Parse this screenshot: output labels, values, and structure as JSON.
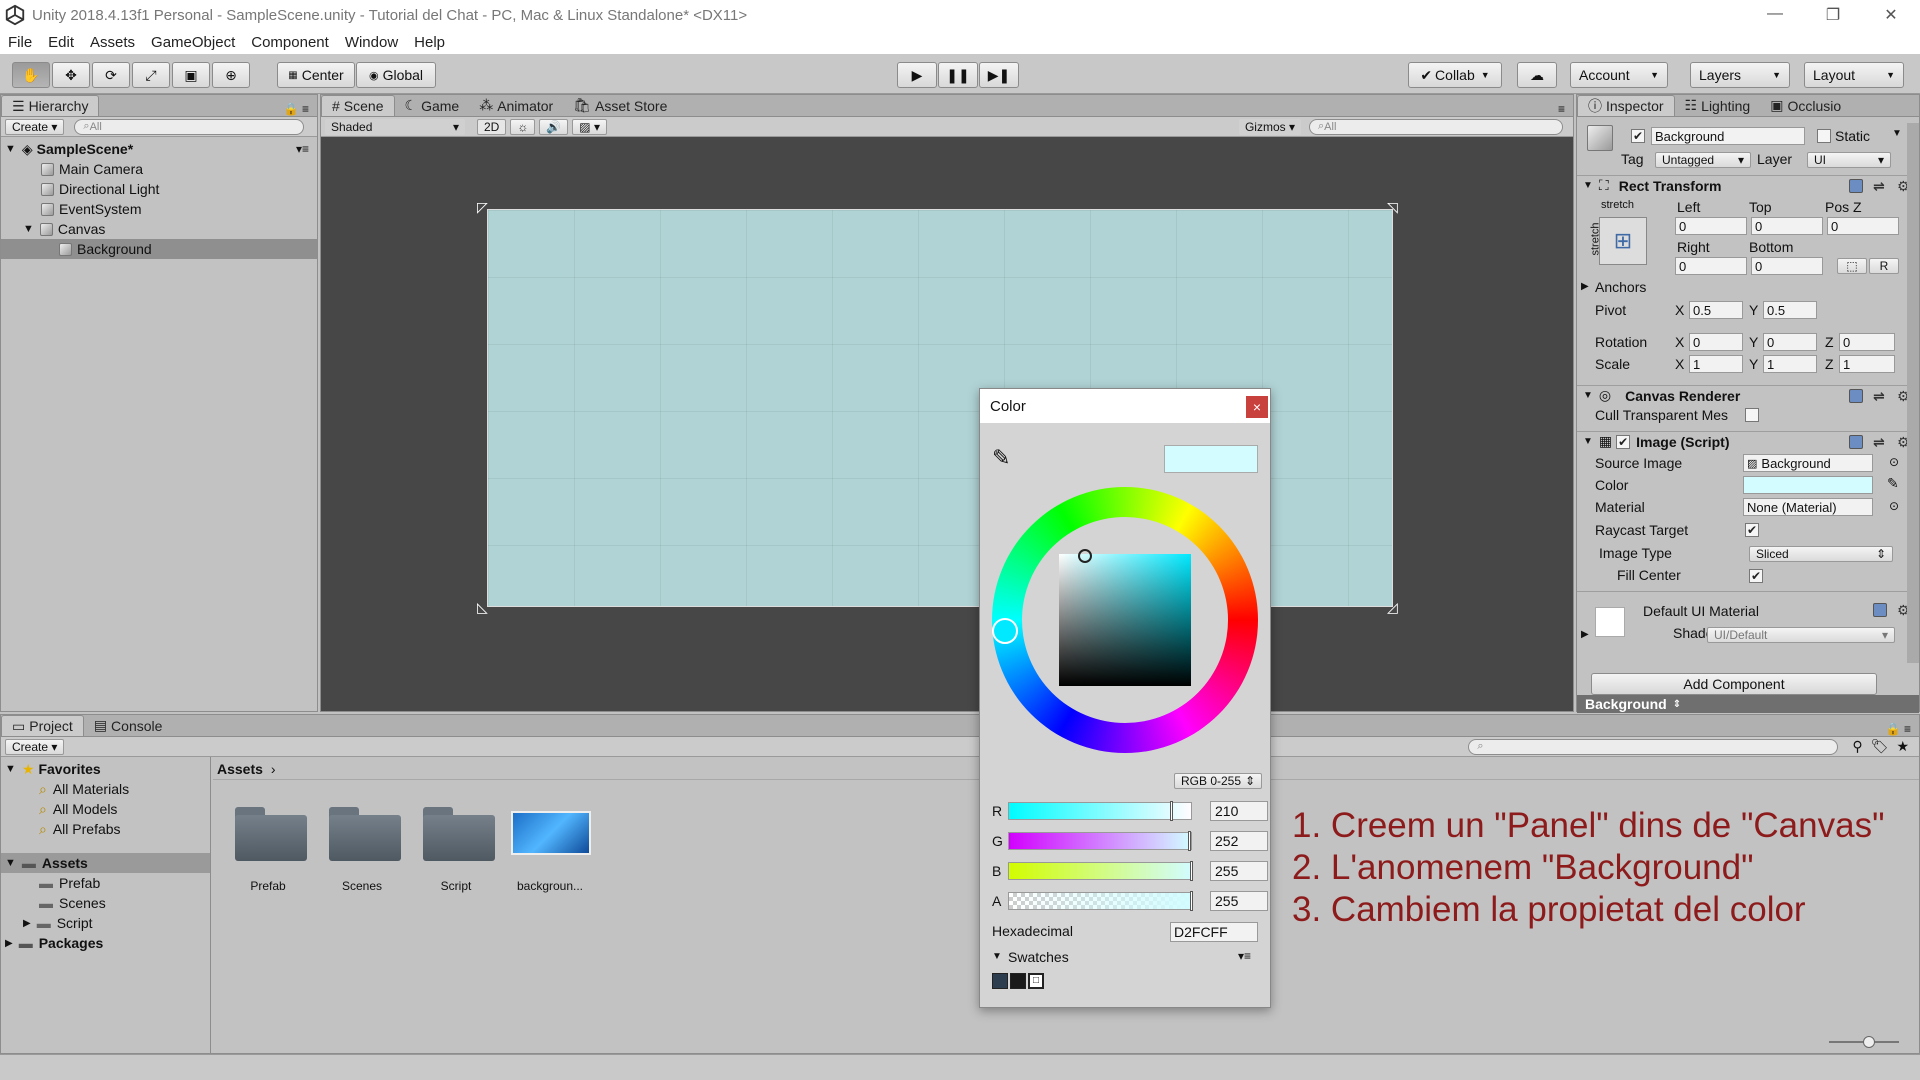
{
  "window": {
    "title": "Unity 2018.4.13f1 Personal - SampleScene.unity - Tutorial del Chat - PC, Mac & Linux Standalone* <DX11>"
  },
  "menu": [
    "File",
    "Edit",
    "Assets",
    "GameObject",
    "Component",
    "Window",
    "Help"
  ],
  "toolbar": {
    "center_label": "Center",
    "global_label": "Global",
    "collab_label": "Collab",
    "account_label": "Account",
    "layers_label": "Layers",
    "layout_label": "Layout"
  },
  "hierarchy": {
    "tab": "Hierarchy",
    "create": "Create",
    "search_placeholder": "All",
    "scene": "SampleScene*",
    "items": [
      "Main Camera",
      "Directional Light",
      "EventSystem",
      "Canvas",
      "Background"
    ]
  },
  "scene_view": {
    "tabs": [
      "Scene",
      "Game",
      "Animator",
      "Asset Store"
    ],
    "shading": "Shaded",
    "mode_2d": "2D",
    "gizmos": "Gizmos",
    "search_placeholder": "All",
    "canvas_color": "#B0D3D5"
  },
  "inspector": {
    "tabs": [
      "Inspector",
      "Lighting",
      "Occlusio"
    ],
    "object_name": "Background",
    "static_label": "Static",
    "tag_label": "Tag",
    "tag_value": "Untagged",
    "layer_label": "Layer",
    "layer_value": "UI",
    "rect_transform": {
      "title": "Rect Transform",
      "stretch": "stretch",
      "left_label": "Left",
      "top_label": "Top",
      "posz_label": "Pos Z",
      "left": "0",
      "top": "0",
      "posz": "0",
      "right_label": "Right",
      "bottom_label": "Bottom",
      "right": "0",
      "bottom": "0",
      "r_button": "R",
      "anchors_label": "Anchors",
      "pivot_label": "Pivot",
      "pivot_x": "0.5",
      "pivot_y": "0.5",
      "rotation_label": "Rotation",
      "rot_x": "0",
      "rot_y": "0",
      "rot_z": "0",
      "scale_label": "Scale",
      "scale_x": "1",
      "scale_y": "1",
      "scale_z": "1",
      "x": "X",
      "y": "Y",
      "z": "Z"
    },
    "canvas_renderer": {
      "title": "Canvas Renderer",
      "cull_label": "Cull Transparent Mes"
    },
    "image_script": {
      "title": "Image (Script)",
      "source_image_label": "Source Image",
      "source_image_value": "Background",
      "color_label": "Color",
      "material_label": "Material",
      "material_value": "None (Material)",
      "raycast_label": "Raycast Target",
      "image_type_label": "Image Type",
      "image_type_value": "Sliced",
      "fill_center_label": "Fill Center"
    },
    "material_block": {
      "name": "Default UI Material",
      "shader_label": "Shader",
      "shader_value": "UI/Default"
    },
    "add_component": "Add Component",
    "footer": "Background"
  },
  "project": {
    "tabs": [
      "Project",
      "Console"
    ],
    "create": "Create",
    "favorites_label": "Favorites",
    "favorites": [
      "All Materials",
      "All Models",
      "All Prefabs"
    ],
    "assets_label": "Assets",
    "asset_folders": [
      "Prefab",
      "Scenes",
      "Script"
    ],
    "packages_label": "Packages",
    "breadcrumb": "Assets",
    "grid_items": [
      "Prefab",
      "Scenes",
      "Script",
      "backgroun..."
    ]
  },
  "color_dialog": {
    "title": "Color",
    "close": "×",
    "mode": "RGB 0-255",
    "channels": [
      {
        "label": "R",
        "value": "210"
      },
      {
        "label": "G",
        "value": "252"
      },
      {
        "label": "B",
        "value": "255"
      },
      {
        "label": "A",
        "value": "255"
      }
    ],
    "hex_label": "Hexadecimal",
    "hex_value": "D2FCFF",
    "swatches_label": "Swatches",
    "preview_color": "#D2FCFF"
  },
  "instructions": [
    "1. Creem un \"Panel\" dins de \"Canvas\"",
    "2. L'anomenem \"Background\"",
    "3. Cambiem la propietat del color"
  ]
}
